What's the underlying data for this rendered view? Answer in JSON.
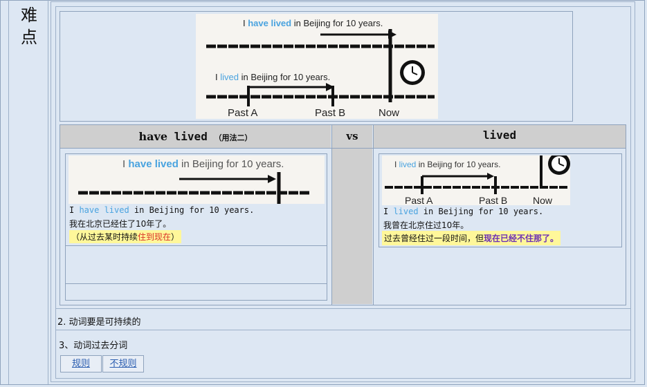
{
  "side_label": [
    "难",
    "点"
  ],
  "diagram_main": {
    "sentence_top_pre": "I ",
    "sentence_top_verb": "have lived",
    "sentence_top_post": " in Beijing for 10 years.",
    "sentence_bottom_pre": "I ",
    "sentence_bottom_verb": "lived",
    "sentence_bottom_post": " in Beijing for 10 years.",
    "past_a": "Past A",
    "past_b": "Past B",
    "now": "Now"
  },
  "compare": {
    "left_header_word": "have",
    "left_header_mono": "lived",
    "left_header_note": "（用法二）",
    "vs": "vs",
    "right_header": "lived",
    "left": {
      "img_text_pre": "I ",
      "img_text_verb": "have lived",
      "img_text_post": " in Beijing for 10 years.",
      "en_pre": "I ",
      "en_verb": "have lived",
      "en_post": " in Beijing for 10 years.",
      "cn": "我在北京已经住了10年了。",
      "note_pre": "（从过去某时持续",
      "note_red": "住到现在",
      "note_post": "）"
    },
    "right": {
      "img_text_pre": "I ",
      "img_text_verb": "lived",
      "img_text_post": " in Beijing for 10 years.",
      "past_a": "Past A",
      "past_b": "Past B",
      "now": "Now",
      "en_pre": "I ",
      "en_verb": "lived",
      "en_post": " in Beijing for 10 years.",
      "cn": "我曾在北京住过10年。",
      "note_pre": "过去曾经住过一段时间，但",
      "note_purple": "现在已经不住那了。"
    }
  },
  "points": {
    "p2": "2. 动词要是可持续的",
    "p3": "3、动词过去分词"
  },
  "links": {
    "regular": "规则",
    "irregular": "不规则"
  },
  "colors": {
    "page_bg": "#dde7f3",
    "verb_blue": "#4aa3df",
    "highlight": "#fff79a",
    "red": "#d93025",
    "purple": "#6b2fb3",
    "header_gray": "#cfcfcf"
  }
}
